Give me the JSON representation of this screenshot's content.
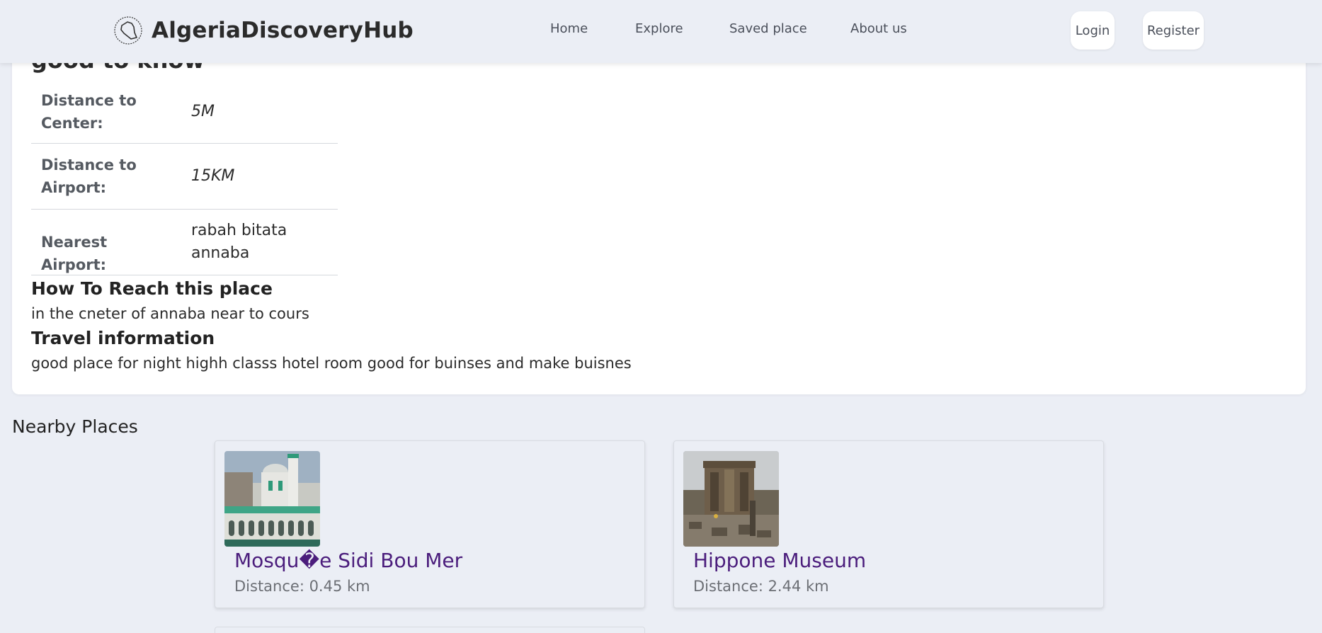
{
  "nav": {
    "brand": "AlgeriaDiscoveryHub",
    "links": [
      "Home",
      "Explore",
      "Saved place",
      "About us"
    ],
    "login": "Login",
    "register": "Register"
  },
  "details": {
    "good_to_know_title": "good to know",
    "rows": [
      {
        "label": "Distance to Center:",
        "value": "5M"
      },
      {
        "label": "Distance to Airport:",
        "value": "15KM"
      },
      {
        "label": "Nearest Airport:",
        "value": "rabah bitata annaba"
      }
    ],
    "reach_heading": "How To Reach this place",
    "reach_text": "in the cneter of annaba near to cours",
    "travel_heading": "Travel information",
    "travel_text": "good place for night highh classs hotel room good for buinses and make buisnes"
  },
  "nearby": {
    "title": "Nearby Places",
    "places": [
      {
        "name": "Mosqu�e Sidi Bou Mer",
        "distance": "Distance: 0.45 km"
      },
      {
        "name": "Hippone Museum",
        "distance": "Distance: 2.44 km"
      }
    ]
  },
  "colors": {
    "background": "#ebeef5",
    "place_link": "#4b1d7c"
  },
  "icons": {
    "brand_logo": "algeria-map-icon"
  }
}
